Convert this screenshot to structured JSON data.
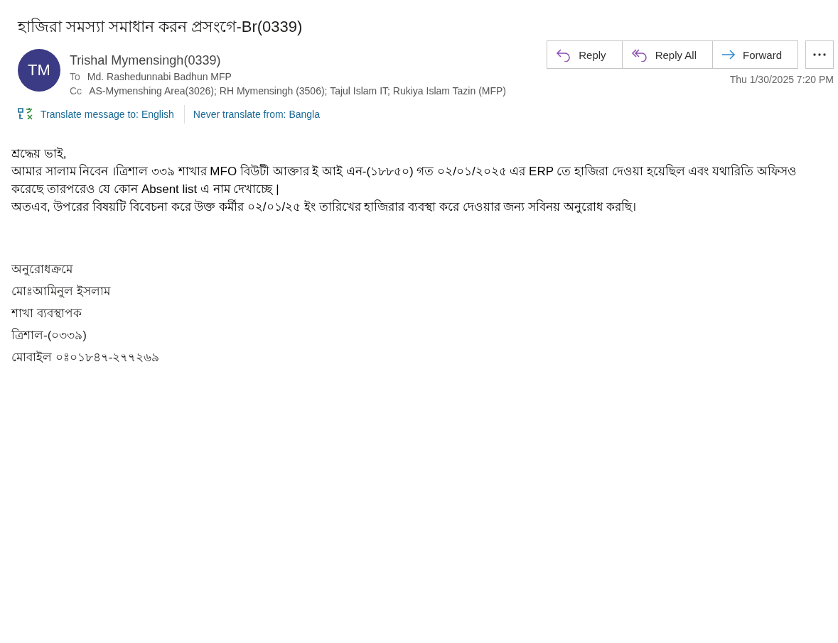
{
  "subject": "হাজিরা সমস্যা সমাধান করন প্রসংগে-Br(0339)",
  "sender": {
    "initials": "TM",
    "name": "Trishal Mymensingh(0339)",
    "to_label": "To",
    "to": "Md. Rashedunnabi Badhun MFP",
    "cc_label": "Cc",
    "cc": "AS-Mymenshing Area(3026); RH Mymensingh (3506); Tajul Islam IT; Rukiya Islam Tazin (MFP)"
  },
  "actions": [
    {
      "kind": "reply",
      "label": "Reply"
    },
    {
      "kind": "reply_all",
      "label": "Reply All"
    },
    {
      "kind": "forward",
      "label": "Forward"
    }
  ],
  "date": "Thu 1/30/2025 7:20 PM",
  "translate": {
    "translate_link": "Translate message to: English",
    "never_link": "Never translate from: Bangla"
  },
  "body": {
    "paragraphs": [
      "শ্রদ্ধেয় ভাই,",
      "আমার সালাম নিবেন ।ত্রিশাল ৩৩৯ শাখার MFO  বিউটী আক্তার ই আই এন-(১৮৮৫০) গত  ০২/০১/২০২৫ এর  ERP তে হাজিরা  দেওয়া হয়েছিল এবং যথারিতি অফিসও করেছে তারপরেও যে কোন Absent list এ নাম দেখাচ্ছে |",
      "অতএব, উপরের বিষয়টি বিবেচনা করে  উক্ত কর্মীর  ০২/০১/২৫ ইং তারিখের  হাজিরার ব্যবস্থা করে  দেওয়ার জন্য সবিনয়  অনুরোধ  করছি।"
    ],
    "signature": [
      "অনুরোধক্রমে",
      "মোঃআমিনুল ইসলাম",
      "শাখা ব্যবস্থাপক",
      "ত্রিশাল-(০৩৩৯)",
      "মোবাইল ০ঃ০১৮৪৭-২৭৭২৬৯"
    ]
  }
}
